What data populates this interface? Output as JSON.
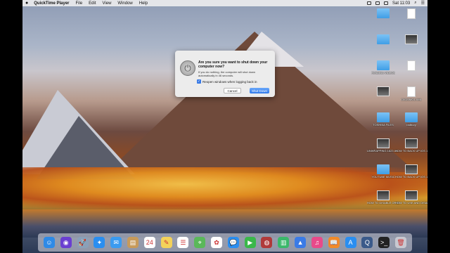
{
  "menubar": {
    "apple_icon": "apple-icon",
    "items": [
      "QuickTime Player",
      "File",
      "Edit",
      "View",
      "Window",
      "Help"
    ],
    "clock": "Sat 11:03"
  },
  "dialog": {
    "title": "Are you sure you want to shut down your computer now?",
    "body": "If you do nothing, the computer will shut down automatically in 46 seconds.",
    "reopen_label": "Reopen windows when logging back in",
    "reopen_checked": true,
    "cancel_label": "Cancel",
    "shutdown_label": "Shut Down"
  },
  "desktop_icons": [
    {
      "label": "",
      "kind": "folder"
    },
    {
      "label": "",
      "kind": "doc"
    },
    {
      "label": "",
      "kind": "folder"
    },
    {
      "label": "",
      "kind": "video"
    },
    {
      "label": "PENDING VIDEOS",
      "kind": "folder"
    },
    {
      "label": "",
      "kind": "doc"
    },
    {
      "label": "",
      "kind": "video"
    },
    {
      "label": "C0020MO1.XML",
      "kind": "doc"
    },
    {
      "label": "TOSHIBA FILES",
      "kind": "folder"
    },
    {
      "label": "radbury",
      "kind": "folder"
    },
    {
      "label": "UNWRAPPING 1623 LK...AD.mp4",
      "kind": "video"
    },
    {
      "label": "HOW TO BACK UP IOS 11 W...NE.mp4",
      "kind": "video"
    },
    {
      "label": "YOUTUBE MUSIC",
      "kind": "folder"
    },
    {
      "label": "HOW TO BACK UP IOS 11 W...NE.mp4",
      "kind": "video"
    },
    {
      "label": "HOW TO DISABLE OR ENA...S 11.mp4",
      "kind": "video"
    },
    {
      "label": "HOW TO USE AND DISABLE...11.mp4",
      "kind": "video"
    }
  ],
  "dock_icons": [
    {
      "name": "finder-icon",
      "glyph": "☺",
      "color": "#2e8ae6"
    },
    {
      "name": "siri-icon",
      "glyph": "◉",
      "color": "#6a3fd1"
    },
    {
      "name": "launchpad-icon",
      "glyph": "🚀",
      "color": "#8aa0b8"
    },
    {
      "name": "safari-icon",
      "glyph": "✦",
      "color": "#2a8ef0"
    },
    {
      "name": "mail-icon",
      "glyph": "✉",
      "color": "#3a9bf0"
    },
    {
      "name": "contacts-icon",
      "glyph": "▤",
      "color": "#c79a5a"
    },
    {
      "name": "calendar-icon",
      "glyph": "24",
      "color": "#ffffff"
    },
    {
      "name": "notes-icon",
      "glyph": "✎",
      "color": "#f3d25a"
    },
    {
      "name": "reminders-icon",
      "glyph": "☰",
      "color": "#ffffff"
    },
    {
      "name": "maps-icon",
      "glyph": "⌖",
      "color": "#5ab85a"
    },
    {
      "name": "photos-icon",
      "glyph": "✿",
      "color": "#ffffff"
    },
    {
      "name": "messages-icon",
      "glyph": "💬",
      "color": "#2a8ef0"
    },
    {
      "name": "facetime-icon",
      "glyph": "▶",
      "color": "#3ab84a"
    },
    {
      "name": "photo-booth-icon",
      "glyph": "◍",
      "color": "#b03a3a"
    },
    {
      "name": "numbers-icon",
      "glyph": "▥",
      "color": "#3ab86a"
    },
    {
      "name": "keynote-icon",
      "glyph": "▲",
      "color": "#3a7be6"
    },
    {
      "name": "itunes-icon",
      "glyph": "♫",
      "color": "#e84a8a"
    },
    {
      "name": "ibooks-icon",
      "glyph": "📖",
      "color": "#f08a2a"
    },
    {
      "name": "app-store-icon",
      "glyph": "A",
      "color": "#2a8ef0"
    },
    {
      "name": "quicktime-icon",
      "glyph": "Q",
      "color": "#3a5a8a"
    },
    {
      "name": "terminal-icon",
      "glyph": ">_",
      "color": "#222222"
    },
    {
      "name": "trash-icon",
      "glyph": "🗑",
      "color": "#c8c8d0"
    }
  ]
}
